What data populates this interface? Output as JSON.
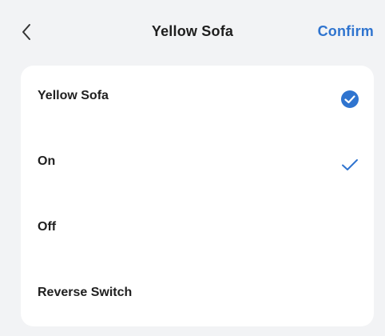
{
  "header": {
    "title": "Yellow Sofa",
    "confirm_label": "Confirm",
    "back_icon": "chevron-left-icon"
  },
  "colors": {
    "accent": "#2f74cf",
    "background": "#f2f3f5",
    "card": "#ffffff",
    "text": "#1f1f1f"
  },
  "options": [
    {
      "label": "Yellow Sofa",
      "indicator": "check-circle-filled-icon",
      "selected": true
    },
    {
      "label": "On",
      "indicator": "check-icon",
      "selected": true
    },
    {
      "label": "Off",
      "indicator": "",
      "selected": false
    },
    {
      "label": "Reverse Switch",
      "indicator": "",
      "selected": false
    }
  ]
}
